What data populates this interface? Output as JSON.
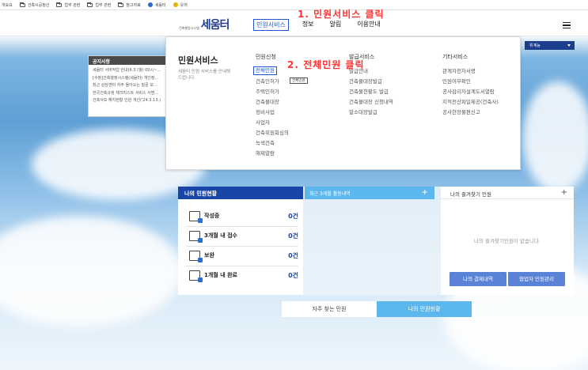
{
  "bookmarks": [
    "개요요",
    "건축시공정산",
    "업무 관련",
    "업무 관련",
    "참고자료",
    "세움터",
    "유저"
  ],
  "header": {
    "logo_text": "세움터",
    "logo_sub": "건축행정시스템",
    "nav": [
      "민원서비스",
      "정보",
      "알림",
      "이용안내"
    ]
  },
  "annotations": {
    "step1": "1. 민원서비스 클릭",
    "step2": "2. 전체민원 클릭"
  },
  "notice": {
    "title": "공지사항",
    "items": [
      "세움터 서버작업 안내(6.3.(월) 00시~...",
      "[수정]건축행정시스템(세움터) 개인정...",
      "최근 상담센터 자주 들어오는 질문 모...",
      "한국건축규정 체크리스트 서비스 서범...",
      "건축사보 해지현황 인원 개선('24.3.13.)"
    ]
  },
  "dropdown": {
    "title": "민원서비스",
    "description": "세움터 민원 서비스를 안내해드립니다.",
    "tooltip": "전체민원",
    "columns": [
      {
        "head": "민원신청",
        "items": [
          "전체민원",
          "건축인허가",
          "주택인허가",
          "건축물대장",
          "정비사업",
          "사업자",
          "건축위원회심의",
          "녹색건축",
          "해제열람"
        ]
      },
      {
        "head": "발급서비스",
        "items": [
          "발급안내",
          "건축물대장발급",
          "건축물현황도 발급",
          "건축물대장 신청내역",
          "말소대장발급"
        ]
      },
      {
        "head": "기타서비스",
        "items": [
          "관계자전자서명",
          "민원여부확인",
          "공사감리자설계도서열람",
          "지적전산파일제공(건축사)",
          "공사현장불편신고"
        ]
      }
    ]
  },
  "select_box": {
    "value": "위계능"
  },
  "panels": {
    "my_status": {
      "title": "나의 민원현황",
      "rows": [
        {
          "label": "작성중",
          "count": "0건"
        },
        {
          "label": "3개월 내 접수",
          "count": "0건"
        },
        {
          "label": "보완",
          "count": "0건"
        },
        {
          "label": "1개월 내 완료",
          "count": "0건"
        }
      ]
    },
    "recent": {
      "title": "최근 3개월 활동내역",
      "plus": "+"
    },
    "favorites": {
      "title": "나의 즐겨찾기 민원",
      "plus": "+",
      "empty": "나의 즐겨찾기민원이 없습니다.",
      "btn_payment": "나의 결제내역",
      "btn_partner": "협업자 민원관리"
    }
  },
  "tabs": {
    "frequent": "자주 찾는 민원",
    "mine": "나의 민원현황"
  }
}
